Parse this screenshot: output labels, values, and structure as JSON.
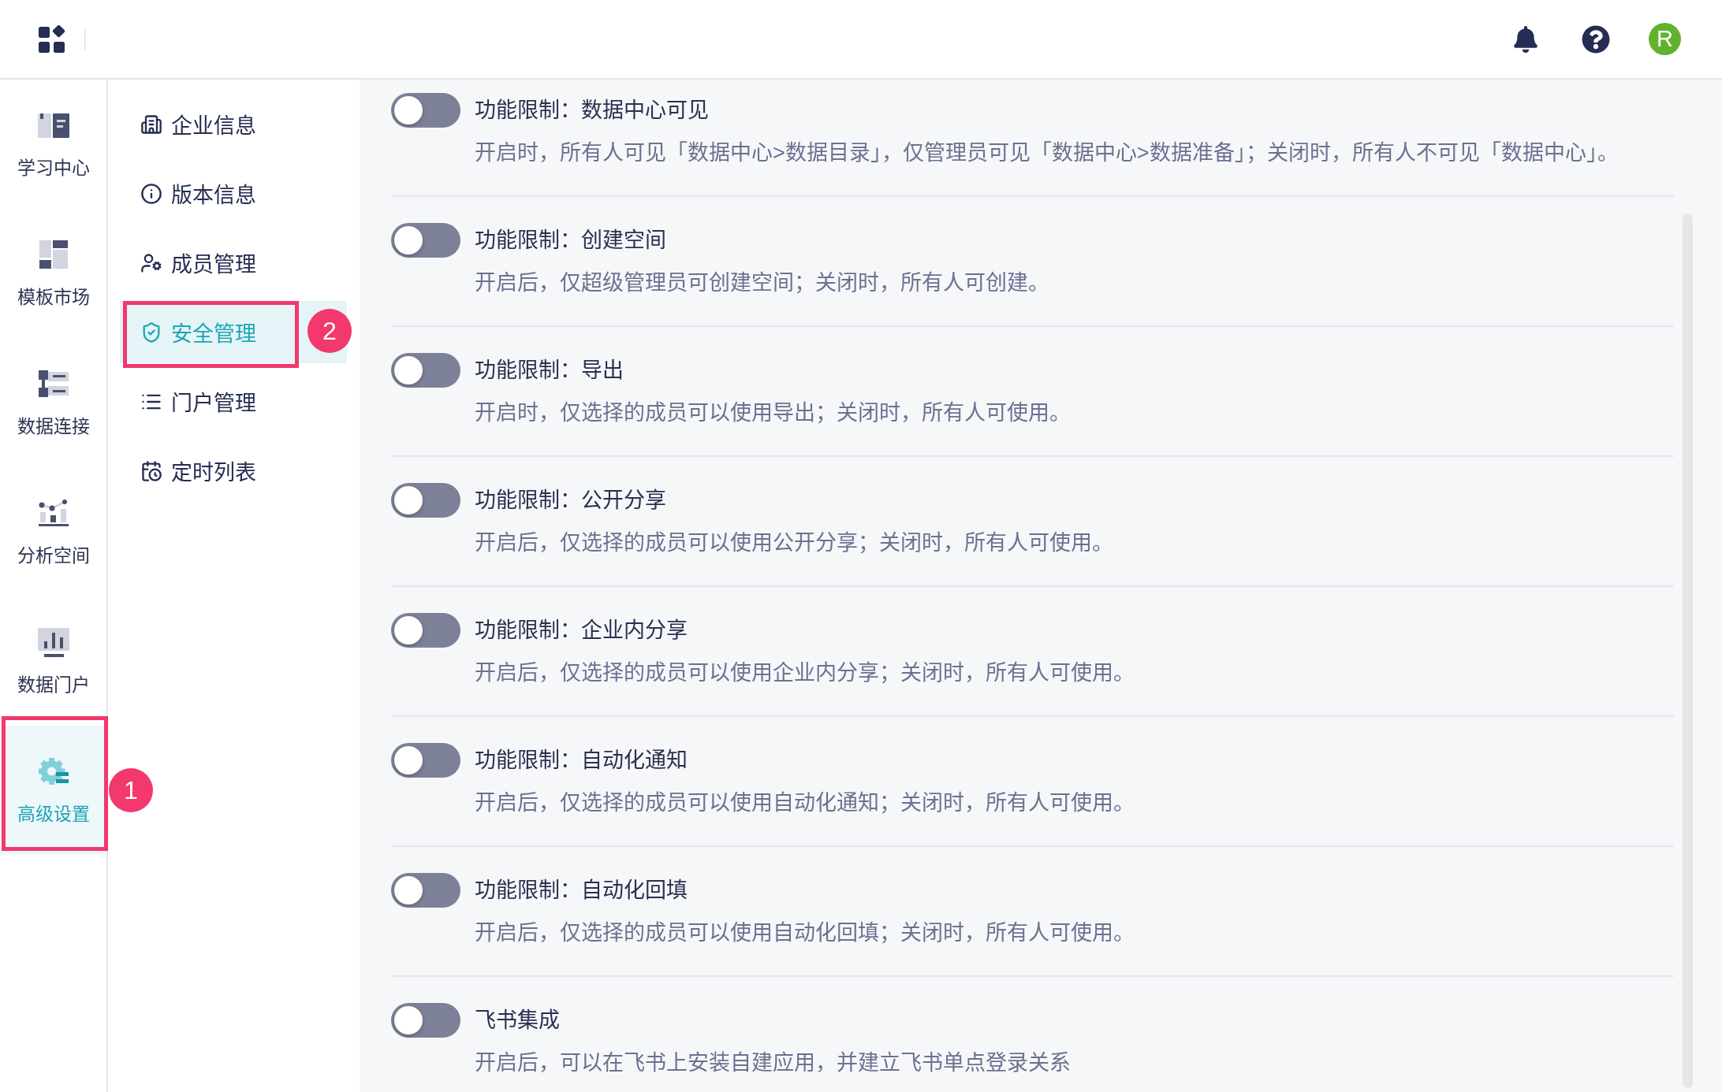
{
  "topbar": {
    "avatar_initial": "R"
  },
  "nav_rail": {
    "items": [
      {
        "label": "学习中心",
        "selected": false
      },
      {
        "label": "模板市场",
        "selected": false
      },
      {
        "label": "数据连接",
        "selected": false
      },
      {
        "label": "分析空间",
        "selected": false
      },
      {
        "label": "数据门户",
        "selected": false
      },
      {
        "label": "高级设置",
        "selected": true,
        "callout": "1"
      }
    ]
  },
  "settings_menu": {
    "items": [
      {
        "label": "企业信息",
        "selected": false
      },
      {
        "label": "版本信息",
        "selected": false
      },
      {
        "label": "成员管理",
        "selected": false
      },
      {
        "label": "安全管理",
        "selected": true,
        "callout": "2"
      },
      {
        "label": "门户管理",
        "selected": false
      },
      {
        "label": "定时列表",
        "selected": false
      }
    ]
  },
  "settings": {
    "items": [
      {
        "title": "功能限制：数据中心可见",
        "description": "开启时，所有人可见「数据中心>数据目录」，仅管理员可见「数据中心>数据准备」；关闭时，所有人不可见「数据中心」。",
        "on": false
      },
      {
        "title": "功能限制：创建空间",
        "description": "开启后，仅超级管理员可创建空间；关闭时，所有人可创建。",
        "on": false
      },
      {
        "title": "功能限制：导出",
        "description": "开启时，仅选择的成员可以使用导出；关闭时，所有人可使用。",
        "on": false
      },
      {
        "title": "功能限制：公开分享",
        "description": "开启后，仅选择的成员可以使用公开分享；关闭时，所有人可使用。",
        "on": false
      },
      {
        "title": "功能限制：企业内分享",
        "description": "开启后，仅选择的成员可以使用企业内分享；关闭时，所有人可使用。",
        "on": false
      },
      {
        "title": "功能限制：自动化通知",
        "description": "开启后，仅选择的成员可以使用自动化通知；关闭时，所有人可使用。",
        "on": false
      },
      {
        "title": "功能限制：自动化回填",
        "description": "开启后，仅选择的成员可以使用自动化回填；关闭时，所有人可使用。",
        "on": false
      },
      {
        "title": "飞书集成",
        "description": "开启后，可以在飞书上安装自建应用，并建立飞书单点登录关系",
        "on": false
      }
    ]
  }
}
